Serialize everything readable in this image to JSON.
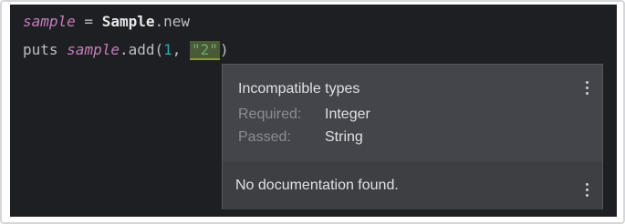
{
  "code": {
    "line1": {
      "var": "sample",
      "assign": " = ",
      "class_name": "Sample",
      "method_call": ".new"
    },
    "line2": {
      "keyword": "puts ",
      "var": "sample",
      "method": ".add(",
      "arg1": "1",
      "sep": ", ",
      "arg2": "\"2\"",
      "close": ")"
    }
  },
  "popup": {
    "title": "Incompatible types",
    "required_label": "Required:",
    "required_value": "Integer",
    "passed_label": "Passed:",
    "passed_value": "String",
    "doc_text": "No documentation found.",
    "menu_icon_top": "more-vertical-icon",
    "menu_icon_bottom": "more-vertical-icon"
  },
  "colors": {
    "editor_bg": "#1e1f22",
    "popup_bg": "#43454a",
    "variable": "#c77dbb",
    "number": "#2aacb8",
    "string": "#6aab73",
    "string_highlight": "#4a5a36"
  }
}
